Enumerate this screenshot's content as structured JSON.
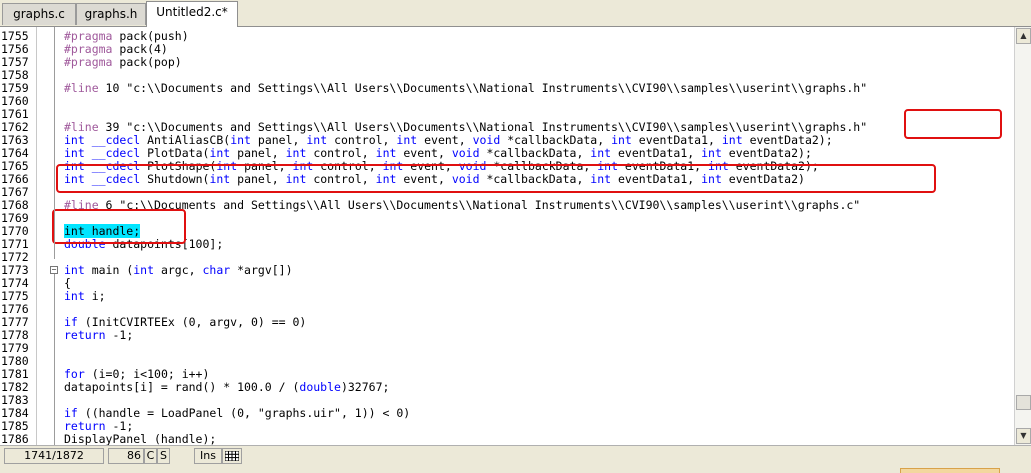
{
  "tabs": [
    {
      "label": "graphs.c",
      "active": false
    },
    {
      "label": "graphs.h",
      "active": false
    },
    {
      "label": "Untitled2.c*",
      "active": true
    }
  ],
  "lines": [
    {
      "num": "1755",
      "parts": [
        {
          "t": "#pragma",
          "c": "pp"
        },
        {
          "t": " pack(push)",
          "c": ""
        }
      ]
    },
    {
      "num": "1756",
      "parts": [
        {
          "t": "#pragma",
          "c": "pp"
        },
        {
          "t": " pack(4)",
          "c": ""
        }
      ]
    },
    {
      "num": "1757",
      "parts": [
        {
          "t": "#pragma",
          "c": "pp"
        },
        {
          "t": " pack(pop)",
          "c": ""
        }
      ]
    },
    {
      "num": "1758",
      "parts": []
    },
    {
      "num": "1759",
      "parts": [
        {
          "t": "#line",
          "c": "pp"
        },
        {
          "t": " 10 \"c:\\\\Documents and Settings\\\\All Users\\\\Documents\\\\National Instruments\\\\CVI90\\\\samples\\\\userint\\\\graphs.h\"",
          "c": ""
        }
      ]
    },
    {
      "num": "1760",
      "parts": []
    },
    {
      "num": "1761",
      "parts": []
    },
    {
      "num": "1762",
      "parts": [
        {
          "t": "#line",
          "c": "pp"
        },
        {
          "t": " 39 \"c:\\\\Documents and Settings\\\\All Users\\\\Documents\\\\National Instruments\\\\CVI90\\\\samples\\\\userint\\\\graphs.h\"",
          "c": ""
        }
      ]
    },
    {
      "num": "1763",
      "parts": [
        {
          "t": "int",
          "c": "kw"
        },
        {
          "t": " ",
          "c": ""
        },
        {
          "t": "__cdecl",
          "c": "kw"
        },
        {
          "t": " AntiAliasCB(",
          "c": ""
        },
        {
          "t": "int",
          "c": "kw"
        },
        {
          "t": " panel, ",
          "c": ""
        },
        {
          "t": "int",
          "c": "kw"
        },
        {
          "t": " control, ",
          "c": ""
        },
        {
          "t": "int",
          "c": "kw"
        },
        {
          "t": " event, ",
          "c": ""
        },
        {
          "t": "void",
          "c": "kw"
        },
        {
          "t": " *callbackData, ",
          "c": ""
        },
        {
          "t": "int",
          "c": "kw"
        },
        {
          "t": " eventData1, ",
          "c": ""
        },
        {
          "t": "int",
          "c": "kw"
        },
        {
          "t": " eventData2);",
          "c": ""
        }
      ]
    },
    {
      "num": "1764",
      "parts": [
        {
          "t": "int",
          "c": "kw"
        },
        {
          "t": " ",
          "c": ""
        },
        {
          "t": "__cdecl",
          "c": "kw"
        },
        {
          "t": " PlotData(",
          "c": ""
        },
        {
          "t": "int",
          "c": "kw"
        },
        {
          "t": " panel, ",
          "c": ""
        },
        {
          "t": "int",
          "c": "kw"
        },
        {
          "t": " control, ",
          "c": ""
        },
        {
          "t": "int",
          "c": "kw"
        },
        {
          "t": " event, ",
          "c": ""
        },
        {
          "t": "void",
          "c": "kw"
        },
        {
          "t": " *callbackData, ",
          "c": ""
        },
        {
          "t": "int",
          "c": "kw"
        },
        {
          "t": " eventData1, ",
          "c": ""
        },
        {
          "t": "int",
          "c": "kw"
        },
        {
          "t": " eventData2);",
          "c": ""
        }
      ]
    },
    {
      "num": "1765",
      "parts": [
        {
          "t": "int",
          "c": "kw"
        },
        {
          "t": " ",
          "c": ""
        },
        {
          "t": "__cdecl",
          "c": "kw"
        },
        {
          "t": " PlotShape(",
          "c": ""
        },
        {
          "t": "int",
          "c": "kw"
        },
        {
          "t": " panel, ",
          "c": ""
        },
        {
          "t": "int",
          "c": "kw"
        },
        {
          "t": " control, ",
          "c": ""
        },
        {
          "t": "int",
          "c": "kw"
        },
        {
          "t": " event, ",
          "c": ""
        },
        {
          "t": "void",
          "c": "kw"
        },
        {
          "t": " *callbackData, ",
          "c": ""
        },
        {
          "t": "int",
          "c": "kw"
        },
        {
          "t": " eventData1, ",
          "c": ""
        },
        {
          "t": "int",
          "c": "kw"
        },
        {
          "t": " eventData2);",
          "c": ""
        }
      ]
    },
    {
      "num": "1766",
      "parts": [
        {
          "t": "int",
          "c": "kw"
        },
        {
          "t": " ",
          "c": ""
        },
        {
          "t": "__cdecl",
          "c": "kw"
        },
        {
          "t": " Shutdown(",
          "c": ""
        },
        {
          "t": "int",
          "c": "kw"
        },
        {
          "t": " panel, ",
          "c": ""
        },
        {
          "t": "int",
          "c": "kw"
        },
        {
          "t": " control, ",
          "c": ""
        },
        {
          "t": "int",
          "c": "kw"
        },
        {
          "t": " event, ",
          "c": ""
        },
        {
          "t": "void",
          "c": "kw"
        },
        {
          "t": " *callbackData, ",
          "c": ""
        },
        {
          "t": "int",
          "c": "kw"
        },
        {
          "t": " eventData1, ",
          "c": ""
        },
        {
          "t": "int",
          "c": "kw"
        },
        {
          "t": " eventData2)",
          "c": ""
        }
      ]
    },
    {
      "num": "1767",
      "parts": []
    },
    {
      "num": "1768",
      "parts": [
        {
          "t": "#line",
          "c": "pp"
        },
        {
          "t": " 6 \"c:\\\\Documents and Settings\\\\All Users\\\\Documents\\\\National Instruments\\\\CVI90\\\\samples\\\\userint\\\\graphs.c\"",
          "c": ""
        }
      ]
    },
    {
      "num": "1769",
      "parts": []
    },
    {
      "num": "1770",
      "parts": [
        {
          "t": "int handle;",
          "c": "hl"
        }
      ]
    },
    {
      "num": "1771",
      "parts": [
        {
          "t": "double",
          "c": "kw"
        },
        {
          "t": " datapoints[100];",
          "c": ""
        }
      ]
    },
    {
      "num": "1772",
      "parts": []
    },
    {
      "num": "1773",
      "parts": [
        {
          "t": "int",
          "c": "kw"
        },
        {
          "t": " main (",
          "c": ""
        },
        {
          "t": "int",
          "c": "kw"
        },
        {
          "t": " argc, ",
          "c": ""
        },
        {
          "t": "char",
          "c": "kw"
        },
        {
          "t": " *argv[])",
          "c": ""
        }
      ]
    },
    {
      "num": "1774",
      "parts": [
        {
          "t": "{",
          "c": ""
        }
      ]
    },
    {
      "num": "1775",
      "parts": [
        {
          "t": "int",
          "c": "kw"
        },
        {
          "t": " i;",
          "c": ""
        }
      ]
    },
    {
      "num": "1776",
      "parts": []
    },
    {
      "num": "1777",
      "parts": [
        {
          "t": "if",
          "c": "kw"
        },
        {
          "t": " (InitCVIRTEEx (0, argv, 0) == 0)",
          "c": ""
        }
      ]
    },
    {
      "num": "1778",
      "parts": [
        {
          "t": "return",
          "c": "kw"
        },
        {
          "t": " -1;",
          "c": ""
        }
      ]
    },
    {
      "num": "1779",
      "parts": []
    },
    {
      "num": "1780",
      "parts": []
    },
    {
      "num": "1781",
      "parts": [
        {
          "t": "for",
          "c": "kw"
        },
        {
          "t": " (i=0; i<100; i++)",
          "c": ""
        }
      ]
    },
    {
      "num": "1782",
      "parts": [
        {
          "t": "datapoints[i] = rand() * 100.0 / (",
          "c": ""
        },
        {
          "t": "double",
          "c": "kw"
        },
        {
          "t": ")32767;",
          "c": ""
        }
      ]
    },
    {
      "num": "1783",
      "parts": []
    },
    {
      "num": "1784",
      "parts": [
        {
          "t": "if",
          "c": "kw"
        },
        {
          "t": " ((handle = LoadPanel (0, \"graphs.uir\", 1)) < 0)",
          "c": ""
        }
      ]
    },
    {
      "num": "1785",
      "parts": [
        {
          "t": "return",
          "c": "kw"
        },
        {
          "t": " -1;",
          "c": ""
        }
      ]
    },
    {
      "num": "1786",
      "parts": [
        {
          "t": "DisplayPanel (handle);",
          "c": ""
        }
      ]
    }
  ],
  "status": {
    "position": "1741/1872",
    "column": "86",
    "c": "C",
    "s": "S",
    "ins": "Ins",
    "grid_icon": "grid-icon"
  },
  "colors": {
    "keyword": "#0000ff",
    "preprocessor": "#a05a9c",
    "highlight": "#00e5ff",
    "annotation": "#e01010"
  }
}
